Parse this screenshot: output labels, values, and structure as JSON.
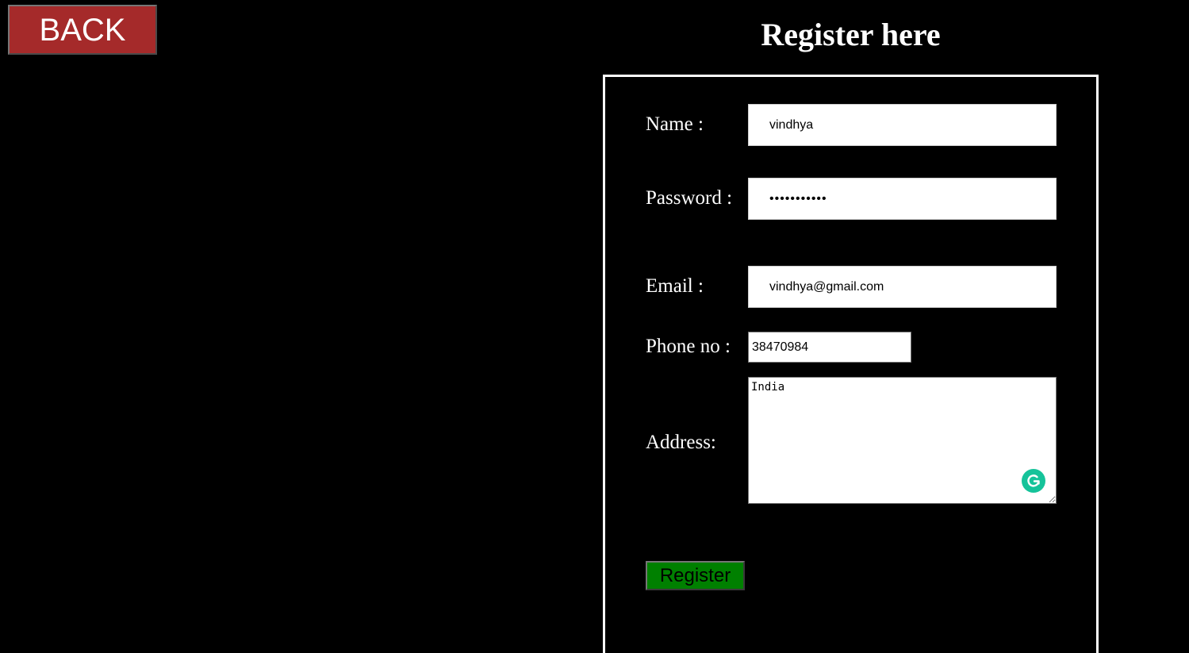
{
  "back_button": {
    "label": "BACK"
  },
  "title": "Register here",
  "form": {
    "name": {
      "label": "Name :",
      "value": "vindhya"
    },
    "password": {
      "label": "Password :",
      "value": "•••••••••••"
    },
    "email": {
      "label": "Email :",
      "value": "vindhya@gmail.com"
    },
    "phone": {
      "label": "Phone no :",
      "value": "38470984"
    },
    "address": {
      "label": "Address:",
      "value": "India"
    },
    "submit_label": "Register"
  },
  "colors": {
    "background": "#000000",
    "back_button": "#a52a2a",
    "register_button": "#008000",
    "grammarly_icon": "#15c39a"
  },
  "icons": {
    "grammarly": "grammarly-icon"
  }
}
